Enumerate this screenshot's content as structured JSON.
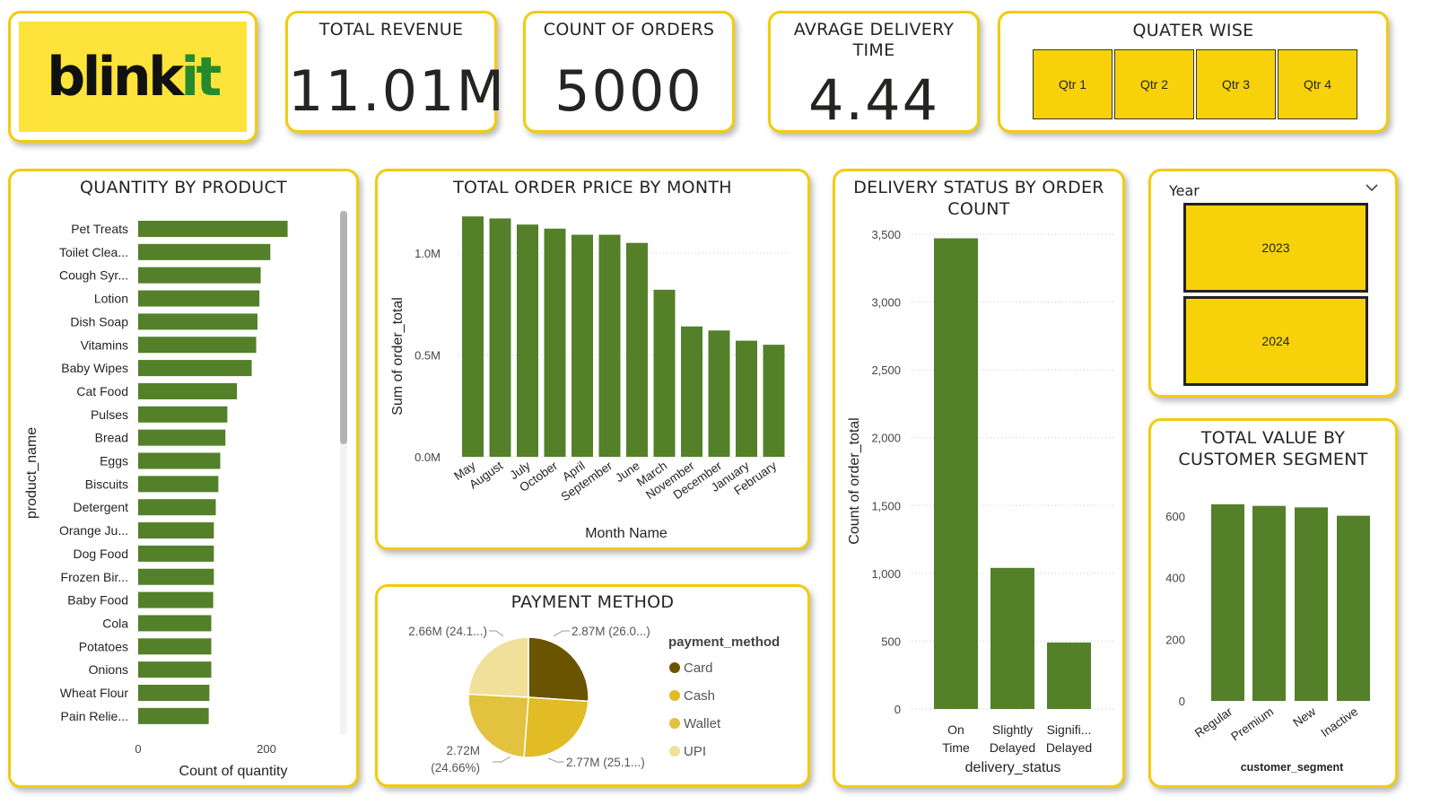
{
  "logo": {
    "text_main": "blink",
    "text_accent": "it"
  },
  "kpis": {
    "revenue": {
      "label": "TOTAL REVENUE",
      "value": "11.01M"
    },
    "orders": {
      "label": "COUNT OF ORDERS",
      "value": "5000"
    },
    "delivery": {
      "label_line1": "AVRAGE DELIVERY",
      "label_line2": "TIME",
      "value": "4.44"
    }
  },
  "quarter_slicer": {
    "title": "QUATER WISE",
    "options": [
      "Qtr 1",
      "Qtr 2",
      "Qtr 3",
      "Qtr 4"
    ]
  },
  "year_slicer": {
    "label": "Year",
    "options": [
      "2023",
      "2024"
    ]
  },
  "colors": {
    "bar": "#548029",
    "accent": "#f7d20a",
    "card_border": "#f2cc0c"
  },
  "chart_data": [
    {
      "id": "qty_by_product",
      "type": "bar",
      "orientation": "horizontal",
      "title": "QUANTITY BY PRODUCT",
      "xlabel": "Count of quantity",
      "ylabel": "product_name",
      "xlim": [
        0,
        330
      ],
      "xticks": [
        "0",
        "200"
      ],
      "categories": [
        "Pet Treats",
        "Toilet Clea...",
        "Cough Syr...",
        "Lotion",
        "Dish Soap",
        "Vitamins",
        "Baby Wipes",
        "Cat Food",
        "Pulses",
        "Bread",
        "Eggs",
        "Biscuits",
        "Detergent",
        "Orange Ju...",
        "Dog Food",
        "Frozen Bir...",
        "Baby Food",
        "Cola",
        "Potatoes",
        "Onions",
        "Wheat Flour",
        "Pain Relie..."
      ],
      "values": [
        233,
        206,
        191,
        189,
        186,
        184,
        177,
        154,
        139,
        136,
        128,
        125,
        121,
        118,
        118,
        118,
        117,
        114,
        114,
        114,
        111,
        110
      ]
    },
    {
      "id": "order_price_by_month",
      "type": "bar",
      "title": "TOTAL ORDER PRICE BY MONTH",
      "xlabel": "Month Name",
      "ylabel": "Sum of order_total",
      "ylim": [
        0,
        1.2
      ],
      "yticks": [
        "0.0M",
        "0.5M",
        "1.0M"
      ],
      "categories": [
        "May",
        "August",
        "July",
        "October",
        "April",
        "September",
        "June",
        "March",
        "November",
        "December",
        "January",
        "February"
      ],
      "values": [
        1.18,
        1.17,
        1.14,
        1.12,
        1.09,
        1.09,
        1.05,
        0.82,
        0.64,
        0.62,
        0.57,
        0.55
      ],
      "unit": "M"
    },
    {
      "id": "delivery_status",
      "type": "bar",
      "title_line1": "DELIVERY STATUS BY ORDER",
      "title_line2": "COUNT",
      "xlabel": "delivery_status",
      "ylabel": "Count of order_total",
      "ylim": [
        0,
        3500
      ],
      "yticks": [
        "0",
        "500",
        "1,000",
        "1,500",
        "2,000",
        "2,500",
        "3,000",
        "3,500"
      ],
      "categories": [
        [
          "On",
          "Time"
        ],
        [
          "Slightly",
          "Delayed"
        ],
        [
          "Signifi...",
          "Delayed"
        ]
      ],
      "values": [
        3470,
        1040,
        490
      ]
    },
    {
      "id": "payment_method",
      "type": "pie",
      "title": "PAYMENT METHOD",
      "legend_title": "payment_method",
      "labels": [
        "Card",
        "Cash",
        "Wallet",
        "UPI"
      ],
      "values": [
        2.87,
        2.77,
        2.72,
        2.66
      ],
      "colors": [
        "#6b5400",
        "#e1bc25",
        "#e2c23e",
        "#f0e09a"
      ],
      "data_labels": [
        "2.87M (26.0...)",
        "2.77M (25.1...)",
        "2.72M",
        "2.66M (24.1...)"
      ],
      "data_label_extra": {
        "wallet": "(24.66%)"
      }
    },
    {
      "id": "customer_segment",
      "type": "bar",
      "title_line1": "TOTAL VALUE BY",
      "title_line2": "CUSTOMER SEGMENT",
      "xlabel": "customer_segment",
      "ylim": [
        0,
        600
      ],
      "yticks": [
        "0",
        "200",
        "400",
        "600"
      ],
      "categories": [
        "Regular",
        "Premium",
        "New",
        "Inactive"
      ],
      "values": [
        638,
        633,
        628,
        601
      ]
    }
  ]
}
